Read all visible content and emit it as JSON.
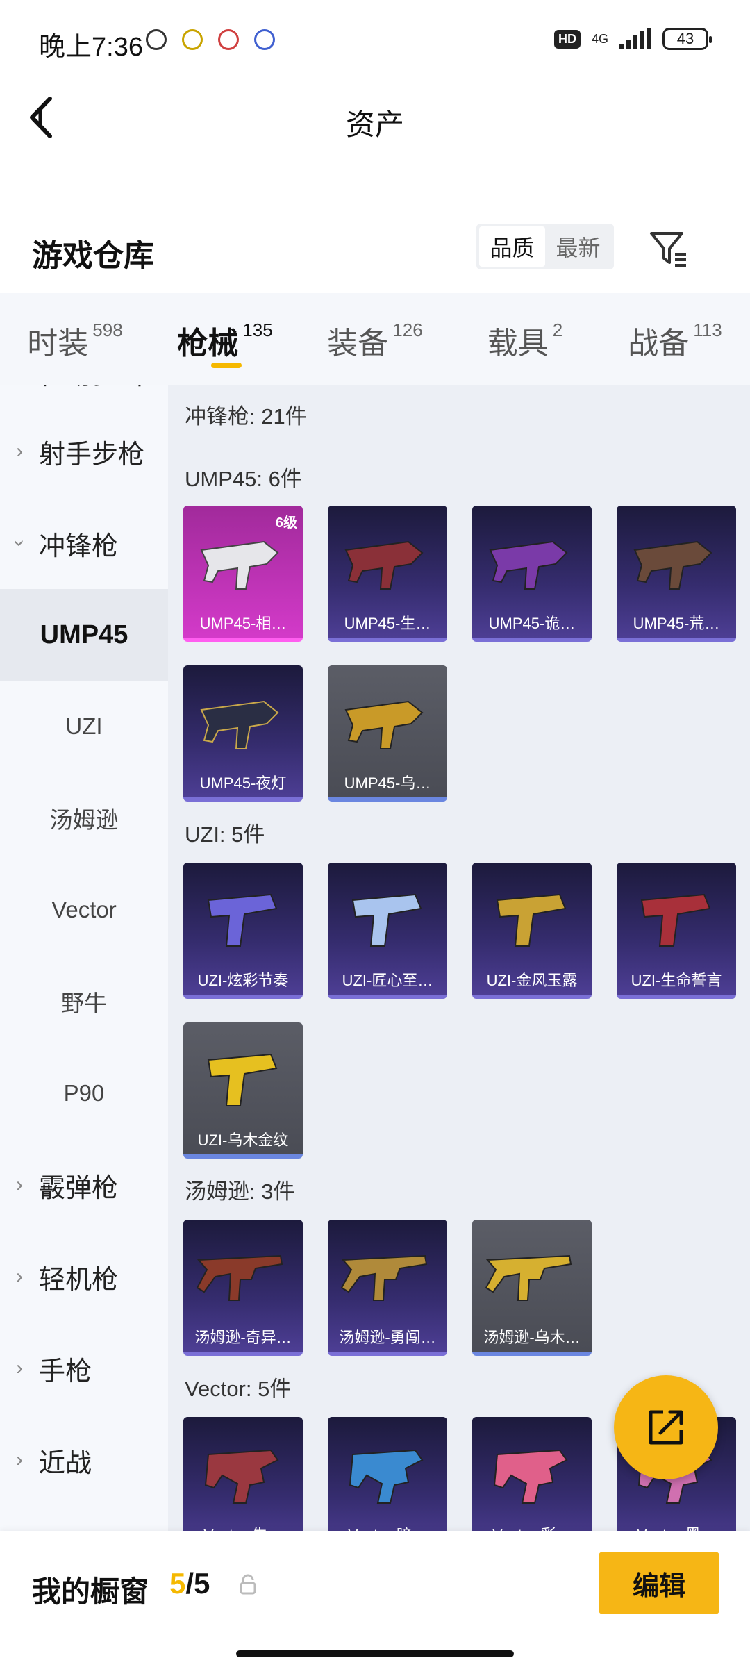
{
  "status_bar": {
    "time": "晚上7:36",
    "hd": "HD",
    "network": "4G",
    "battery": "43"
  },
  "header": {
    "title": "资产"
  },
  "section": {
    "title": "游戏仓库",
    "sort_options": [
      "品质",
      "最新"
    ],
    "active_sort": "品质"
  },
  "category_tabs": [
    {
      "label": "时装",
      "count": "598"
    },
    {
      "label": "枪械",
      "count": "135",
      "active": true
    },
    {
      "label": "装备",
      "count": "126"
    },
    {
      "label": "载具",
      "count": "2"
    },
    {
      "label": "战备",
      "count": "113"
    }
  ],
  "sidebar": {
    "partial_top": "栓动狙击",
    "items": [
      {
        "label": "射手步枪"
      },
      {
        "label": "冲锋枪",
        "expanded": true
      },
      {
        "label": "霰弹枪"
      },
      {
        "label": "轻机枪"
      },
      {
        "label": "手枪"
      },
      {
        "label": "近战"
      }
    ],
    "subitems": [
      "UMP45",
      "UZI",
      "汤姆逊",
      "Vector",
      "野牛",
      "P90"
    ],
    "active_sub": "UMP45"
  },
  "content": {
    "category_title": "冲锋枪: 21件",
    "groups": [
      {
        "title": "UMP45: 6件",
        "items": [
          {
            "name": "UMP45-相…",
            "level": "6级",
            "color": "pink"
          },
          {
            "name": "UMP45-生…",
            "color": "purple"
          },
          {
            "name": "UMP45-诡…",
            "color": "purple"
          },
          {
            "name": "UMP45-荒…",
            "color": "purple"
          },
          {
            "name": "UMP45-夜灯",
            "color": "purple"
          },
          {
            "name": "UMP45-乌…",
            "color": "gray"
          }
        ]
      },
      {
        "title": "UZI: 5件",
        "items": [
          {
            "name": "UZI-炫彩节奏",
            "color": "purple"
          },
          {
            "name": "UZI-匠心至…",
            "color": "purple"
          },
          {
            "name": "UZI-金风玉露",
            "color": "purple"
          },
          {
            "name": "UZI-生命誓言",
            "color": "purple"
          },
          {
            "name": "UZI-乌木金纹",
            "color": "gray"
          }
        ]
      },
      {
        "title": "汤姆逊: 3件",
        "items": [
          {
            "name": "汤姆逊-奇异…",
            "color": "purple"
          },
          {
            "name": "汤姆逊-勇闯…",
            "color": "purple"
          },
          {
            "name": "汤姆逊-乌木…",
            "color": "gray"
          }
        ]
      },
      {
        "title": "Vector: 5件",
        "items": [
          {
            "name": "Vector-生…",
            "color": "purple"
          },
          {
            "name": "Vector-暗…",
            "color": "purple"
          },
          {
            "name": "Vector-彩…",
            "color": "purple"
          },
          {
            "name": "Vector-黑…",
            "color": "purple"
          }
        ]
      }
    ]
  },
  "bottom_bar": {
    "label": "我的橱窗",
    "current": "5",
    "total": "/5",
    "edit_label": "编辑"
  },
  "colors": {
    "accent": "#f6b615",
    "tab_underline": "#f5b800",
    "item_purple": "#352c6e",
    "item_gray": "#4a4c55",
    "item_pink": "#d33ac9"
  }
}
